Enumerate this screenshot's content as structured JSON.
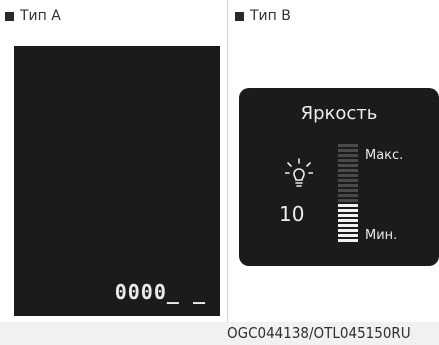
{
  "type_a": {
    "label": "Тип A",
    "readout": "0000_ _"
  },
  "type_b": {
    "label": "Тип B",
    "title": "Яркость",
    "level": "10",
    "max_label": "Макс.",
    "min_label": "Мин.",
    "bulb_icon": "brightness-bulb-icon",
    "level_fraction": 0.4
  },
  "code": "OGC044138/OTL045150RU",
  "colors": {
    "panel": "#1b1b1b",
    "text_light": "#ececec"
  }
}
